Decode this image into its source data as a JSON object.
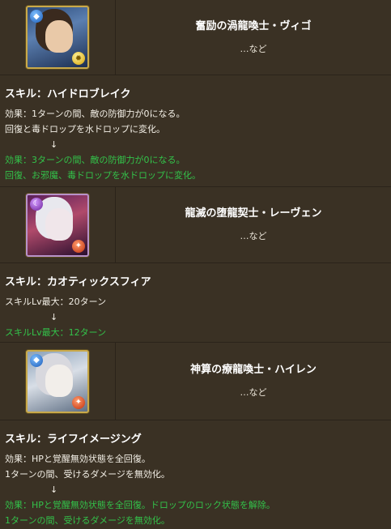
{
  "cards": [
    {
      "name": "奮励の渦龍喚士・ヴィゴ",
      "etc": "…など",
      "main_attr_icon": "water-orb-icon",
      "sub_attr_icon": "light-orb-icon",
      "skill_title": "スキル：ハイドロブレイク",
      "before": [
        "効果：1ターンの間、敵の防御力が0になる。",
        "回復と毒ドロップを水ドロップに変化。"
      ],
      "arrow": "↓",
      "after": [
        "効果：3ターンの間、敵の防御力が0になる。",
        "回復、お邪魔、毒ドロップを水ドロップに変化。"
      ]
    },
    {
      "name": "龍滅の堕龍契士・レーヴェン",
      "etc": "…など",
      "main_attr_icon": "dark-orb-icon",
      "sub_attr_icon": "fire-orb-icon",
      "skill_title": "スキル：カオティックスフィア",
      "before": [
        "スキルLv最大：20ターン"
      ],
      "arrow": "↓",
      "after": [
        "スキルLv最大：12ターン"
      ]
    },
    {
      "name": "神算の療龍喚士・ハイレン",
      "etc": "…など",
      "main_attr_icon": "water-orb-icon",
      "sub_attr_icon": "fire-orb-icon",
      "skill_title": "スキル：ライフイメージング",
      "before": [
        "効果：HPと覚醒無効状態を全回復。",
        "1ターンの間、受けるダメージを無効化。"
      ],
      "arrow": "↓",
      "after": [
        "効果：HPと覚醒無効状態を全回復。ドロップのロック状態を解除。",
        "1ターンの間、受けるダメージを無効化。"
      ]
    }
  ],
  "colors": {
    "background": "#3d3427",
    "highlight_text": "#33c24a",
    "border": "#2a231a"
  }
}
